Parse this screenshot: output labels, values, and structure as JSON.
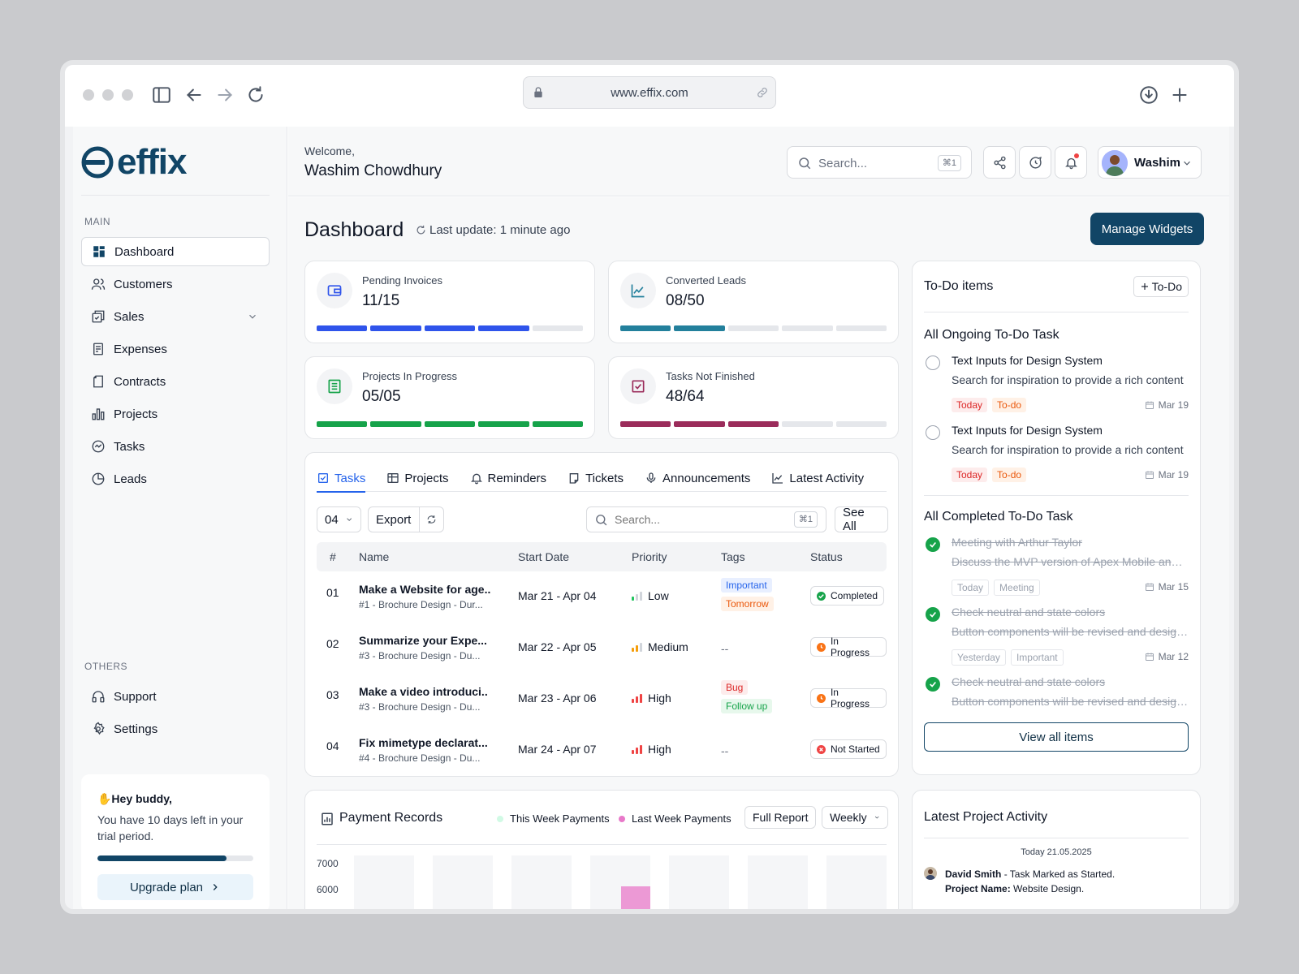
{
  "browser": {
    "url": "www.effix.com"
  },
  "brand": {
    "name": "effix",
    "color": "#114566"
  },
  "sidebar": {
    "main_label": "MAIN",
    "items": [
      {
        "label": "Dashboard",
        "icon": "grid-icon",
        "active": true
      },
      {
        "label": "Customers",
        "icon": "users-icon"
      },
      {
        "label": "Sales",
        "icon": "sales-icon"
      },
      {
        "label": "Expenses",
        "icon": "receipt-icon"
      },
      {
        "label": "Contracts",
        "icon": "contract-icon"
      },
      {
        "label": "Projects",
        "icon": "bar-chart-icon"
      },
      {
        "label": "Tasks",
        "icon": "task-icon"
      },
      {
        "label": "Leads",
        "icon": "pie-icon"
      }
    ],
    "others_label": "OTHERS",
    "others": [
      {
        "label": "Support",
        "icon": "headphones-icon"
      },
      {
        "label": "Settings",
        "icon": "gear-icon"
      }
    ],
    "promo": {
      "greeting": "✋Hey buddy,",
      "message": "You have 10 days left in your trial period.",
      "progress": 0.83,
      "button": "Upgrade plan"
    }
  },
  "header": {
    "welcome": "Welcome,",
    "user_name": "Washim Chowdhury",
    "search_placeholder": "Search...",
    "search_shortcut": "⌘1",
    "profile_name": "Washim"
  },
  "dashboard": {
    "title": "Dashboard",
    "last_update": "Last update: 1 minute ago",
    "manage_button": "Manage Widgets",
    "stats": [
      {
        "label": "Pending Invoices",
        "value": "11/15",
        "filled": 4,
        "total": 5,
        "color": "#2f54eb"
      },
      {
        "label": "Converted Leads",
        "value": "08/50",
        "filled": 2,
        "total": 5,
        "color": "#23809c"
      },
      {
        "label": "Projects In Progress",
        "value": "05/05",
        "filled": 5,
        "total": 5,
        "color": "#16a34a"
      },
      {
        "label": "Tasks Not Finished",
        "value": "48/64",
        "filled": 3,
        "total": 5,
        "color": "#9b2c5b"
      }
    ]
  },
  "tasks_panel": {
    "tabs": [
      {
        "label": "Tasks",
        "active": true
      },
      {
        "label": "Projects"
      },
      {
        "label": "Reminders"
      },
      {
        "label": "Tickets"
      },
      {
        "label": "Announcements"
      },
      {
        "label": "Latest Activity"
      }
    ],
    "page_size": "04",
    "export": "Export",
    "search_placeholder": "Search...",
    "search_shortcut": "⌘1",
    "see_all": "See All",
    "columns": [
      "#",
      "Name",
      "Start Date",
      "Priority",
      "Tags",
      "Status"
    ],
    "rows": [
      {
        "num": "01",
        "name": "Make a Website for age..",
        "sub": "#1 - Brochure Design - Dur...",
        "dates": "Mar 21 - Apr 04",
        "priority": "Low",
        "level": 1,
        "prio_color": "#22c55e",
        "tags": [
          {
            "label": "Important",
            "fg": "#2563eb",
            "bg": "#e8efff"
          },
          {
            "label": "Tomorrow",
            "fg": "#ea580c",
            "bg": "#fff1e6"
          }
        ],
        "status": "Completed",
        "status_color": "#16a34a"
      },
      {
        "num": "02",
        "name": "Summarize your Expe...",
        "sub": "#3 - Brochure Design - Du...",
        "dates": "Mar 22 - Apr 05",
        "priority": "Medium",
        "level": 2,
        "prio_color": "#f59e0b",
        "tags": [],
        "empty_tag": "--",
        "status": "In Progress",
        "status_color": "#f97316"
      },
      {
        "num": "03",
        "name": "Make a video introduci..",
        "sub": "#3 - Brochure Design - Du...",
        "dates": "Mar 23 - Apr 06",
        "priority": "High",
        "level": 3,
        "prio_color": "#ef4444",
        "tags": [
          {
            "label": "Bug",
            "fg": "#dc2626",
            "bg": "#fdecec"
          },
          {
            "label": "Follow up",
            "fg": "#16a34a",
            "bg": "#e7f8ec"
          }
        ],
        "status": "In Progress",
        "status_color": "#f97316"
      },
      {
        "num": "04",
        "name": "Fix mimetype declarat...",
        "sub": "#4 - Brochure Design - Du...",
        "dates": "Mar 24 - Apr 07",
        "priority": "High",
        "level": 3,
        "prio_color": "#ef4444",
        "tags": [],
        "empty_tag": "--",
        "status": "Not Started",
        "status_color": "#ef4444"
      }
    ]
  },
  "todo": {
    "title": "To-Do items",
    "add_button": "To-Do",
    "ongoing_title": "All Ongoing To-Do Task",
    "ongoing": [
      {
        "title": "Text Inputs for Design System",
        "desc": "Search for inspiration to provide a rich content",
        "tags": [
          "Today",
          "To-do"
        ],
        "date": "Mar 19"
      },
      {
        "title": "Text Inputs for Design System",
        "desc": "Search for inspiration to provide a rich content",
        "tags": [
          "Today",
          "To-do"
        ],
        "date": "Mar 19"
      }
    ],
    "completed_title": "All Completed To-Do Task",
    "completed": [
      {
        "title": "Meeting with Arthur Taylor",
        "desc": "Discuss the MVP version of Apex Mobile and the plan",
        "tags": [
          "Today",
          "Meeting"
        ],
        "date": "Mar 15"
      },
      {
        "title": "Check neutral and state colors",
        "desc": "Button components will be revised and designed",
        "tags": [
          "Yesterday",
          "Important"
        ],
        "date": "Mar 12"
      },
      {
        "title": "Check neutral and state colors",
        "desc": "Button components will be revised and designed",
        "tags": [],
        "date": ""
      }
    ],
    "view_all": "View all items"
  },
  "payments": {
    "title": "Payment Records",
    "legend": [
      {
        "label": "This Week Payments",
        "color": "#d1fae5"
      },
      {
        "label": "Last Week Payments",
        "color": "#e879c9"
      }
    ],
    "full_report": "Full Report",
    "period": "Weekly"
  },
  "chart_data": {
    "type": "bar",
    "title": "Payment Records",
    "y_ticks": [
      "7000",
      "6000"
    ],
    "series": [
      {
        "name": "This Week Payments",
        "color": "#d1fae5"
      },
      {
        "name": "Last Week Payments",
        "color": "#e879c9"
      }
    ]
  },
  "activity": {
    "title": "Latest Project Activity",
    "date": "Today 21.05.2025",
    "entry_user": "David Smith",
    "entry_action": " - Task Marked as Started.",
    "entry_project_label": "Project Name:",
    "entry_project": " Website Design."
  }
}
